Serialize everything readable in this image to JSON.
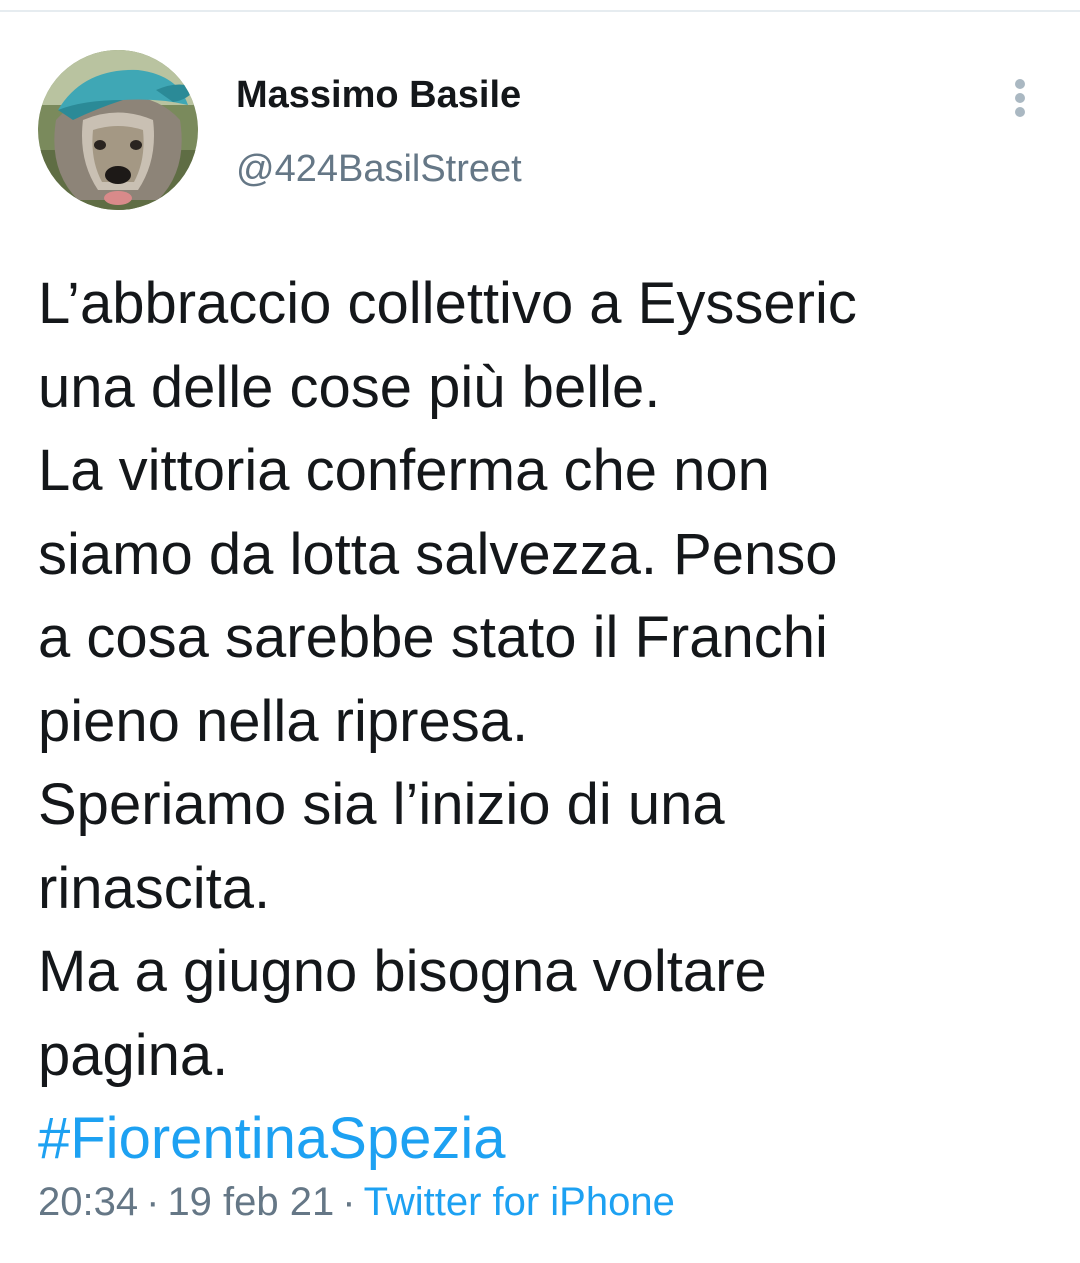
{
  "tweet": {
    "author": {
      "name": "Massimo Basile",
      "handle": "@424BasilStreet"
    },
    "text_lines": [
      "L’abbraccio collettivo a Eysseric",
      "una delle cose più belle.",
      "La vittoria conferma che non",
      "siamo da lotta salvezza. Penso",
      "a cosa sarebbe stato il Franchi",
      "pieno nella ripresa.",
      "Speriamo sia l’inizio di una",
      "rinascita.",
      "Ma a giugno bisogna voltare",
      "pagina."
    ],
    "hashtag": "#FiorentinaSpezia",
    "time": "20:34",
    "separator": "·",
    "date": "19 feb 21",
    "source": "Twitter for iPhone"
  },
  "icons": {
    "more": "more-vertical-icon",
    "avatar": "dog-with-cap-avatar"
  },
  "colors": {
    "text": "#14171a",
    "secondary": "#657786",
    "link": "#1da1f2",
    "divider": "#e6ecf0"
  }
}
